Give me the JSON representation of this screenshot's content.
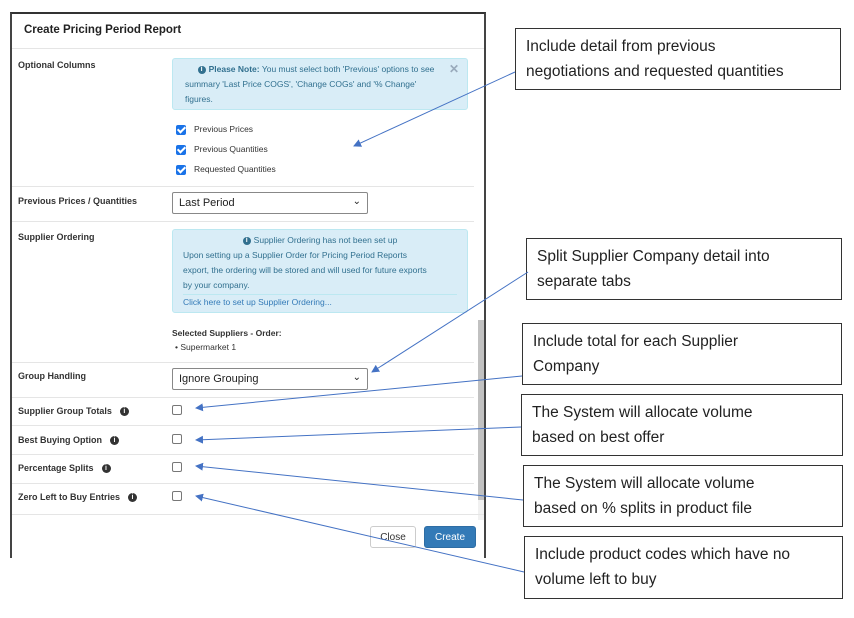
{
  "modal": {
    "title": "Create Pricing Period Report",
    "optional_columns": {
      "label": "Optional Columns",
      "note_bold": "Please Note:",
      "note_text": "You must select both 'Previous' options to see",
      "note_line2": "summary 'Last Price COGS', 'Change COGs' and '% Change'",
      "note_line3": "figures.",
      "checkboxes": [
        {
          "label": "Previous Prices",
          "checked": true
        },
        {
          "label": "Previous Quantities",
          "checked": true
        },
        {
          "label": "Requested Quantities",
          "checked": true
        }
      ]
    },
    "prev_prices": {
      "label": "Previous Prices / Quantities",
      "value": "Last Period"
    },
    "supplier_ordering": {
      "label": "Supplier Ordering",
      "notice": "Supplier Ordering has not been set up",
      "line1": "Upon setting up a Supplier Order for Pricing Period Reports",
      "line2": "export, the ordering will be stored and will used for future exports",
      "line3": "by your company.",
      "link": "Click here to set up Supplier Ordering...",
      "selected_heading": "Selected Suppliers - Order:",
      "selected_item": "Supermarket 1"
    },
    "group_handling": {
      "label": "Group Handling",
      "value": "Ignore Grouping"
    },
    "options": [
      {
        "label": "Supplier Group Totals",
        "checked": false
      },
      {
        "label": "Best Buying Option",
        "checked": false
      },
      {
        "label": "Percentage Splits",
        "checked": false
      },
      {
        "label": "Zero Left to Buy Entries",
        "checked": false
      }
    ],
    "buttons": {
      "close": "Close",
      "create": "Create"
    }
  },
  "callouts": [
    {
      "line1": "Include detail from previous",
      "line2": "negotiations and requested quantities"
    },
    {
      "line1": "Split Supplier Company detail into",
      "line2": "separate tabs"
    },
    {
      "line1": "Include total for each Supplier",
      "line2": "Company"
    },
    {
      "line1": "The System will allocate volume",
      "line2": "based on best offer"
    },
    {
      "line1": "The System will allocate volume",
      "line2": "based on % splits in product file"
    },
    {
      "line1": "Include product codes which have no",
      "line2": "volume left to buy"
    }
  ],
  "colors": {
    "accent": "#337ab7",
    "info_bg": "#d9edf7",
    "arrow": "#4472c4"
  }
}
